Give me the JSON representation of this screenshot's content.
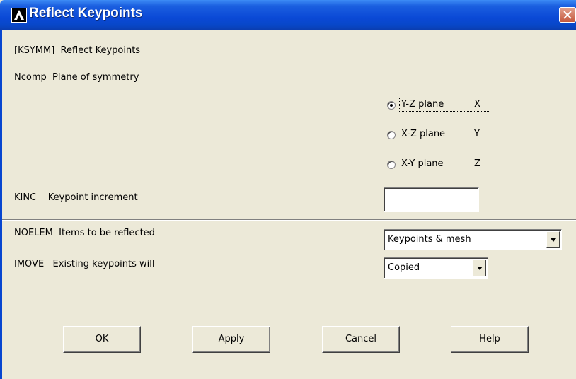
{
  "window": {
    "title": "Reflect Keypoints"
  },
  "form": {
    "command_line": "[KSYMM]  Reflect Keypoints",
    "ncomp_label": "Ncomp  Plane of symmetry",
    "plane_options": [
      {
        "label": "Y-Z plane",
        "axis": "X",
        "checked": true
      },
      {
        "label": "X-Z plane",
        "axis": "Y",
        "checked": false
      },
      {
        "label": "X-Y plane",
        "axis": "Z",
        "checked": false
      }
    ],
    "kinc_label": "KINC    Keypoint increment",
    "kinc_value": "",
    "noelem_label": "NOELEM  Items to be reflected",
    "noelem_value": "Keypoints & mesh",
    "imove_label": "IMOVE   Existing keypoints will",
    "imove_value": "Copied"
  },
  "buttons": {
    "ok": "OK",
    "apply": "Apply",
    "cancel": "Cancel",
    "help": "Help"
  },
  "colors": {
    "titlebar": "#0a49d6",
    "dialog_bg": "#ece9d8"
  }
}
